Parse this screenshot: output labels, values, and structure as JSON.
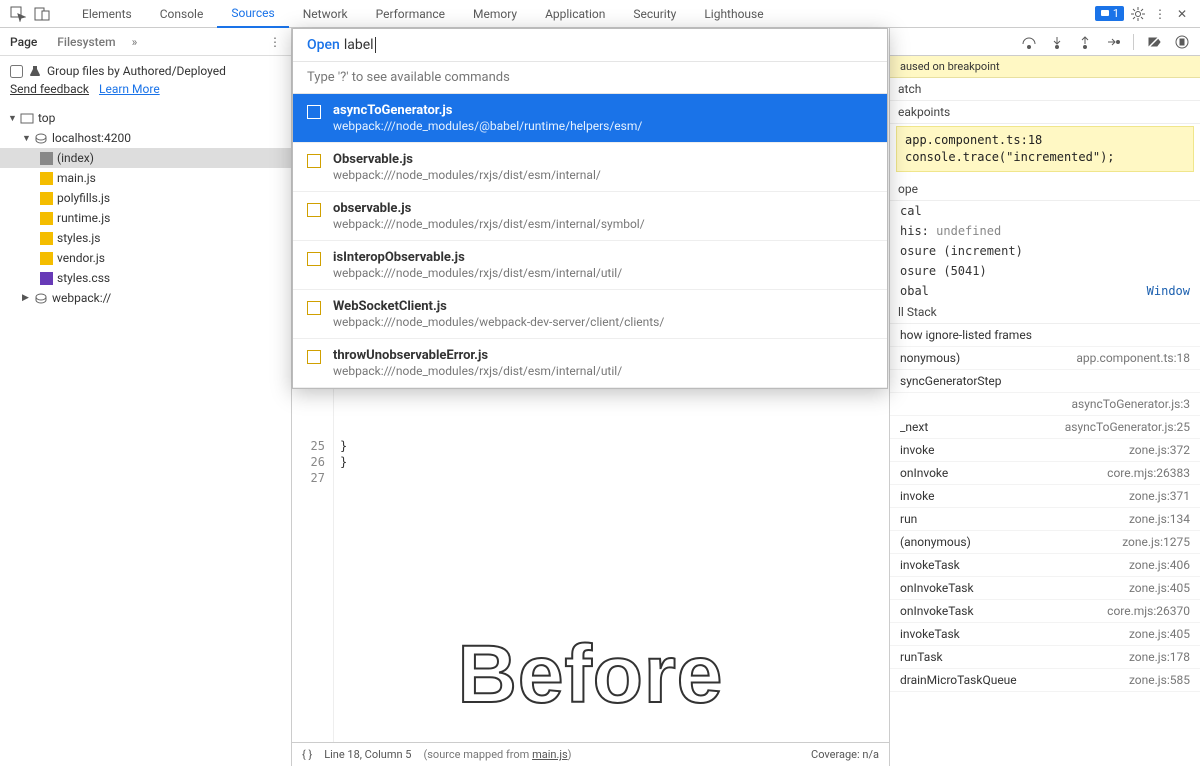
{
  "topTabs": [
    "Elements",
    "Console",
    "Sources",
    "Network",
    "Performance",
    "Memory",
    "Application",
    "Security",
    "Lighthouse"
  ],
  "activeTopTab": "Sources",
  "badgeCount": "1",
  "leftTabs": {
    "page": "Page",
    "filesystem": "Filesystem"
  },
  "groupLabel": "Group files by Authored/Deployed",
  "feedback": "Send feedback",
  "learnMore": "Learn More",
  "tree": {
    "top": "top",
    "host": "localhost:4200",
    "files": [
      "(index)",
      "main.js",
      "polyfills.js",
      "runtime.js",
      "styles.js",
      "vendor.js",
      "styles.css"
    ],
    "webpack": "webpack://"
  },
  "popup": {
    "openLabel": "Open",
    "query": "label",
    "hint": "Type '?' to see available commands",
    "items": [
      {
        "title": "asyncToGenerator.js",
        "path": "webpack:///node_modules/@babel/runtime/helpers/esm/",
        "hl": "abel"
      },
      {
        "title": "Observable.js",
        "path": "webpack:///node_modules/rxjs/dist/esm/internal/",
        "hl": "al"
      },
      {
        "title": "observable.js",
        "path": "webpack:///node_modules/rxjs/dist/esm/internal/symbol/",
        "hl": "al"
      },
      {
        "title": "isInteropObservable.js",
        "path": "webpack:///node_modules/rxjs/dist/esm/internal/util/",
        "hl": "al"
      },
      {
        "title": "WebSocketClient.js",
        "path": "webpack:///node_modules/webpack-dev-server/client/clients/",
        "hl": "a"
      },
      {
        "title": "throwUnobservableError.js",
        "path": "webpack:///node_modules/rxjs/dist/esm/internal/util/",
        "hl": "al"
      }
    ]
  },
  "paused": "aused on breakpoint",
  "rightSections": {
    "watch": "atch",
    "breakpoints": "eakpoints",
    "scope": "ope",
    "callstack": "ll Stack"
  },
  "breakpoint": {
    "file": "app.component.ts:18",
    "code": "console.trace(\"incremented\");"
  },
  "scope": {
    "local": "cal",
    "thisLabel": "his:",
    "thisVal": "undefined",
    "closure1": "osure (increment)",
    "closure2": "osure (5041)",
    "global": "obal",
    "globalVal": "Window"
  },
  "ignoreListed": "how ignore-listed frames",
  "stack": [
    {
      "fn": "nonymous)",
      "loc": "app.component.ts:18"
    },
    {
      "fn": "syncGeneratorStep",
      "loc": ""
    },
    {
      "fn": "",
      "loc": "asyncToGenerator.js:3"
    },
    {
      "fn": "_next",
      "loc": "asyncToGenerator.js:25"
    },
    {
      "fn": "invoke",
      "loc": "zone.js:372"
    },
    {
      "fn": "onInvoke",
      "loc": "core.mjs:26383"
    },
    {
      "fn": "invoke",
      "loc": "zone.js:371"
    },
    {
      "fn": "run",
      "loc": "zone.js:134"
    },
    {
      "fn": "(anonymous)",
      "loc": "zone.js:1275"
    },
    {
      "fn": "invokeTask",
      "loc": "zone.js:406"
    },
    {
      "fn": "onInvokeTask",
      "loc": "zone.js:405"
    },
    {
      "fn": "onInvokeTask",
      "loc": "core.mjs:26370"
    },
    {
      "fn": "invokeTask",
      "loc": "zone.js:405"
    },
    {
      "fn": "runTask",
      "loc": "zone.js:178"
    },
    {
      "fn": "drainMicroTaskQueue",
      "loc": "zone.js:585"
    }
  ],
  "gutter": [
    "25",
    "26",
    "27"
  ],
  "codeLines": [
    "}",
    "}",
    ""
  ],
  "status": {
    "braces": "{ }",
    "pos": "Line 18, Column 5",
    "mapped": "(source mapped from ",
    "mappedFile": "main.js",
    "mappedEnd": ")",
    "coverage": "Coverage: n/a"
  },
  "watermark": "Before"
}
